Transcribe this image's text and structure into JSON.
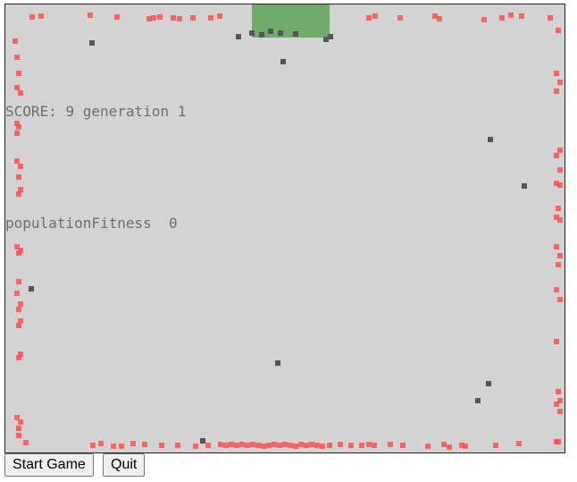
{
  "hud": {
    "score_label": "SCORE:",
    "score": "9",
    "generation_label": "generation",
    "generation": "1",
    "fitness_label": "populationFitness",
    "fitness": "0"
  },
  "buttons": {
    "start": "Start Game",
    "quit": "Quit"
  },
  "colors": {
    "background": "#d3d3d3",
    "goal": "#6aa866",
    "agent_alive": "#ff4b4b",
    "obstacle": "#555555"
  }
}
